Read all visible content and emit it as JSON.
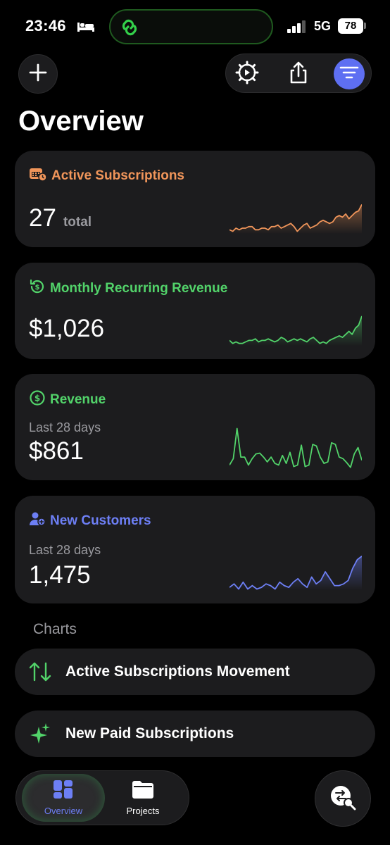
{
  "status_bar": {
    "time": "23:46",
    "network": "5G",
    "battery": "78"
  },
  "page": {
    "title": "Overview"
  },
  "cards": [
    {
      "title": "Active Subscriptions",
      "value": "27",
      "unit": "total",
      "color": "#f0955a",
      "spark": [
        22,
        23,
        21,
        22,
        21,
        21,
        20,
        20,
        22,
        22,
        21,
        21,
        22,
        20,
        20,
        19,
        21,
        20,
        19,
        18,
        20,
        23,
        21,
        19,
        18,
        21,
        20,
        19,
        17,
        16,
        17,
        18,
        17,
        14,
        13,
        14,
        12,
        15,
        13,
        11,
        10,
        6
      ]
    },
    {
      "title": "Monthly Recurring Revenue",
      "value": "$1,026",
      "color": "#52d36a",
      "spark": [
        22,
        24,
        23,
        24,
        24,
        23,
        22,
        22,
        21,
        23,
        22,
        22,
        21,
        22,
        23,
        22,
        20,
        21,
        23,
        22,
        21,
        22,
        21,
        22,
        23,
        21,
        20,
        22,
        24,
        23,
        24,
        22,
        21,
        20,
        19,
        20,
        18,
        16,
        18,
        14,
        12,
        6
      ]
    },
    {
      "title": "Revenue",
      "subtitle": "Last 28 days",
      "value": "$861",
      "color": "#52d36a",
      "spark": [
        50,
        42,
        4,
        40,
        40,
        50,
        42,
        36,
        35,
        40,
        46,
        40,
        48,
        50,
        38,
        48,
        34,
        52,
        50,
        25,
        52,
        50,
        24,
        26,
        40,
        48,
        46,
        22,
        24,
        40,
        42,
        47,
        53,
        36,
        28,
        44
      ]
    },
    {
      "title": "New Customers",
      "subtitle": "Last 28 days",
      "value": "1,475",
      "color": "#6d7ff5",
      "spark": [
        40,
        36,
        42,
        34,
        42,
        38,
        42,
        40,
        36,
        38,
        42,
        34,
        38,
        40,
        34,
        30,
        36,
        40,
        28,
        36,
        32,
        22,
        30,
        38,
        38,
        36,
        32,
        18,
        8,
        4
      ]
    }
  ],
  "section": {
    "label": "Charts"
  },
  "rows": [
    {
      "label": "Active Subscriptions Movement",
      "icon": "arrows-up-down-icon"
    },
    {
      "label": "New Paid Subscriptions",
      "icon": "sparkles-icon"
    }
  ],
  "tabs": [
    {
      "label": "Overview",
      "icon": "dashboard-grid-icon",
      "active": true
    },
    {
      "label": "Projects",
      "icon": "folder-icon",
      "active": false
    }
  ],
  "accent": "#5e6ff2"
}
